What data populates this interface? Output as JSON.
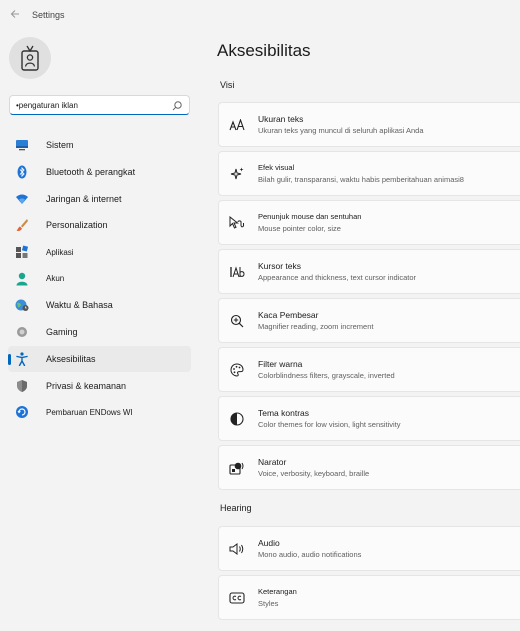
{
  "window": {
    "title": "Settings",
    "back_icon": "arrow-left-icon"
  },
  "search": {
    "value": "•pengaturan iklan",
    "placeholder": "",
    "icon": "search-icon"
  },
  "sidebar": {
    "items": [
      {
        "label": "Sistem",
        "icon": "monitor-icon",
        "active": false
      },
      {
        "label": "Bluetooth & perangkat",
        "icon": "bluetooth-icon",
        "active": false
      },
      {
        "label": "Jaringan & internet",
        "icon": "wifi-icon",
        "active": false
      },
      {
        "label": "Personalization",
        "icon": "brush-icon",
        "active": false
      },
      {
        "label": "Aplikasi",
        "icon": "apps-icon",
        "active": false
      },
      {
        "label": "Akun",
        "icon": "person-icon",
        "active": false
      },
      {
        "label": "Waktu & Bahasa",
        "icon": "globe-clock-icon",
        "active": false
      },
      {
        "label": "Gaming",
        "icon": "gamepad-icon",
        "active": false
      },
      {
        "label": "Aksesibilitas",
        "icon": "accessibility-icon",
        "active": true
      },
      {
        "label": "Privasi & keamanan",
        "icon": "shield-icon",
        "active": false
      },
      {
        "label": "Pembaruan ENDows WI",
        "icon": "windows-update-icon",
        "active": false
      }
    ]
  },
  "main": {
    "title": "Aksesibilitas",
    "sections": [
      {
        "title": "Visi",
        "cards": [
          {
            "title": "Ukuran teks",
            "subtitle": "Ukuran teks yang muncul di seluruh aplikasi Anda",
            "icon": "text-size-icon"
          },
          {
            "title": "Efek visual",
            "subtitle": "Bilah gulir, transparansi, waktu habis pemberitahuan animasi8",
            "icon": "sparkle-icon"
          },
          {
            "title": "Penunjuk mouse dan sentuhan",
            "subtitle": "Mouse pointer color, size",
            "icon": "mouse-pointer-icon"
          },
          {
            "title": "Kursor teks",
            "subtitle": "Appearance and thickness, text cursor indicator",
            "icon": "text-cursor-icon"
          },
          {
            "title": "Kaca Pembesar",
            "subtitle": "Magnifier reading, zoom increment",
            "icon": "magnifier-icon"
          },
          {
            "title": "Filter warna",
            "subtitle": "Colorblindness filters, grayscale, inverted",
            "icon": "color-palette-icon"
          },
          {
            "title": "Tema kontras",
            "subtitle": "Color themes for low vision, light sensitivity",
            "icon": "contrast-icon"
          },
          {
            "title": "Narator",
            "subtitle": "Voice, verbosity, keyboard, braille",
            "icon": "narrator-icon"
          }
        ]
      },
      {
        "title": "Hearing",
        "cards": [
          {
            "title": "Audio",
            "subtitle": "Mono audio, audio notifications",
            "icon": "speaker-icon"
          },
          {
            "title": "Keterangan",
            "subtitle": "Styles",
            "icon": "captions-icon"
          }
        ]
      }
    ]
  },
  "colors": {
    "accent": "#0067c0",
    "background": "#f3f3f3",
    "card": "#fbfbfb"
  }
}
